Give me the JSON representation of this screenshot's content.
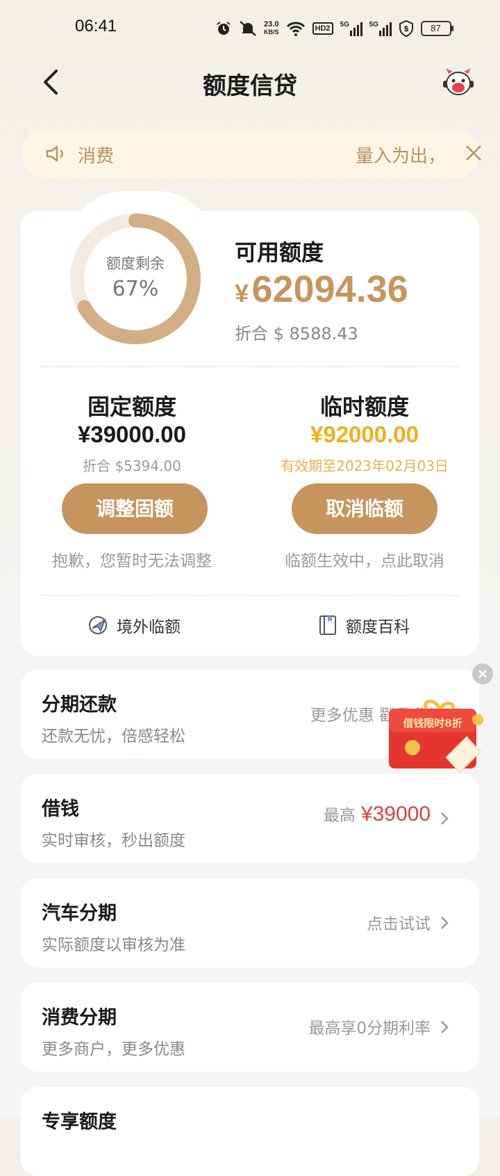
{
  "status_bar": {
    "time": "06:41",
    "speed_value": "23.0",
    "speed_unit": "KB/S",
    "hd": "HD2",
    "net1": "5G",
    "net2": "5G",
    "battery": "87"
  },
  "header": {
    "title": "额度信贷"
  },
  "notice": {
    "text_left": "消费",
    "text_right": "量入为出，"
  },
  "summary": {
    "ring_label": "额度剩余",
    "ring_value": "67%",
    "ring_percent": 67,
    "available_label": "可用额度",
    "currency": "¥",
    "available_amount": "62094.36",
    "converted": "折合 $ 8588.43"
  },
  "fixed": {
    "title": "固定额度",
    "amount": "¥39000.00",
    "sub": "折合 $5394.00",
    "button": "调整固额",
    "note": "抱歉，您暂时无法调整"
  },
  "temporary": {
    "title": "临时额度",
    "amount": "¥92000.00",
    "sub": "有效期至2023年02月03日",
    "button": "取消临额",
    "note": "临额生效中，点此取消"
  },
  "links": {
    "overseas": "境外临额",
    "wiki": "额度百科"
  },
  "list": [
    {
      "title": "分期还款",
      "subtitle": "还款无忧，倍感轻松",
      "right": "更多优惠 戳我参与"
    },
    {
      "title": "借钱",
      "subtitle": "实时审核，秒出额度",
      "right_prefix": "最高",
      "right_value": "¥39000"
    },
    {
      "title": "汽车分期",
      "subtitle": "实际额度以审核为准",
      "right": "点击试试"
    },
    {
      "title": "消费分期",
      "subtitle": "更多商户，更多优惠",
      "right": "最高享0分期利率"
    },
    {
      "title": "专享额度"
    }
  ],
  "promo": {
    "text": "借钱限时8折"
  },
  "colors": {
    "accent": "#c6955e",
    "temp_amount": "#f0b01e",
    "loan_red": "#e04040"
  }
}
